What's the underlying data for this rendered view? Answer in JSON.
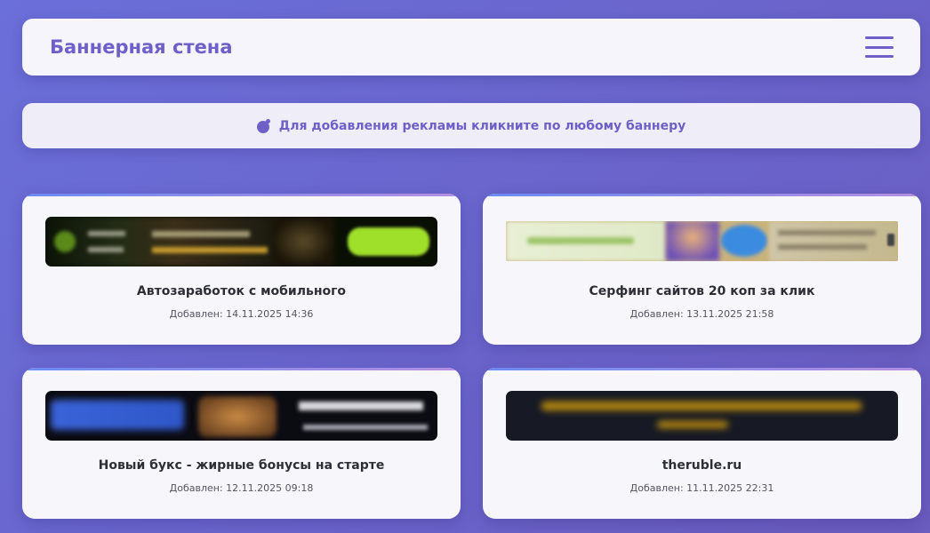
{
  "header": {
    "title": "Баннерная стена",
    "menu_icon": "hamburger-menu-icon"
  },
  "notice": {
    "icon": "bomb-icon",
    "text": "Для добавления рекламы кликните по любому баннеру"
  },
  "colors": {
    "accent": "#6f60c9",
    "background_start": "#6b6fd9",
    "background_end": "#6b5cbf",
    "card": "#f7f6fb"
  },
  "banners": [
    {
      "title": "Автозаработок с мобильного",
      "date": "Добавлен: 14.11.2025 14:36"
    },
    {
      "title": "Серфинг сайтов 20 коп за клик",
      "date": "Добавлен: 13.11.2025 21:58"
    },
    {
      "title": "Новый букс - жирные бонусы на старте",
      "date": "Добавлен: 12.11.2025 09:18"
    },
    {
      "title": "theruble.ru",
      "date": "Добавлен: 11.11.2025 22:31"
    }
  ]
}
